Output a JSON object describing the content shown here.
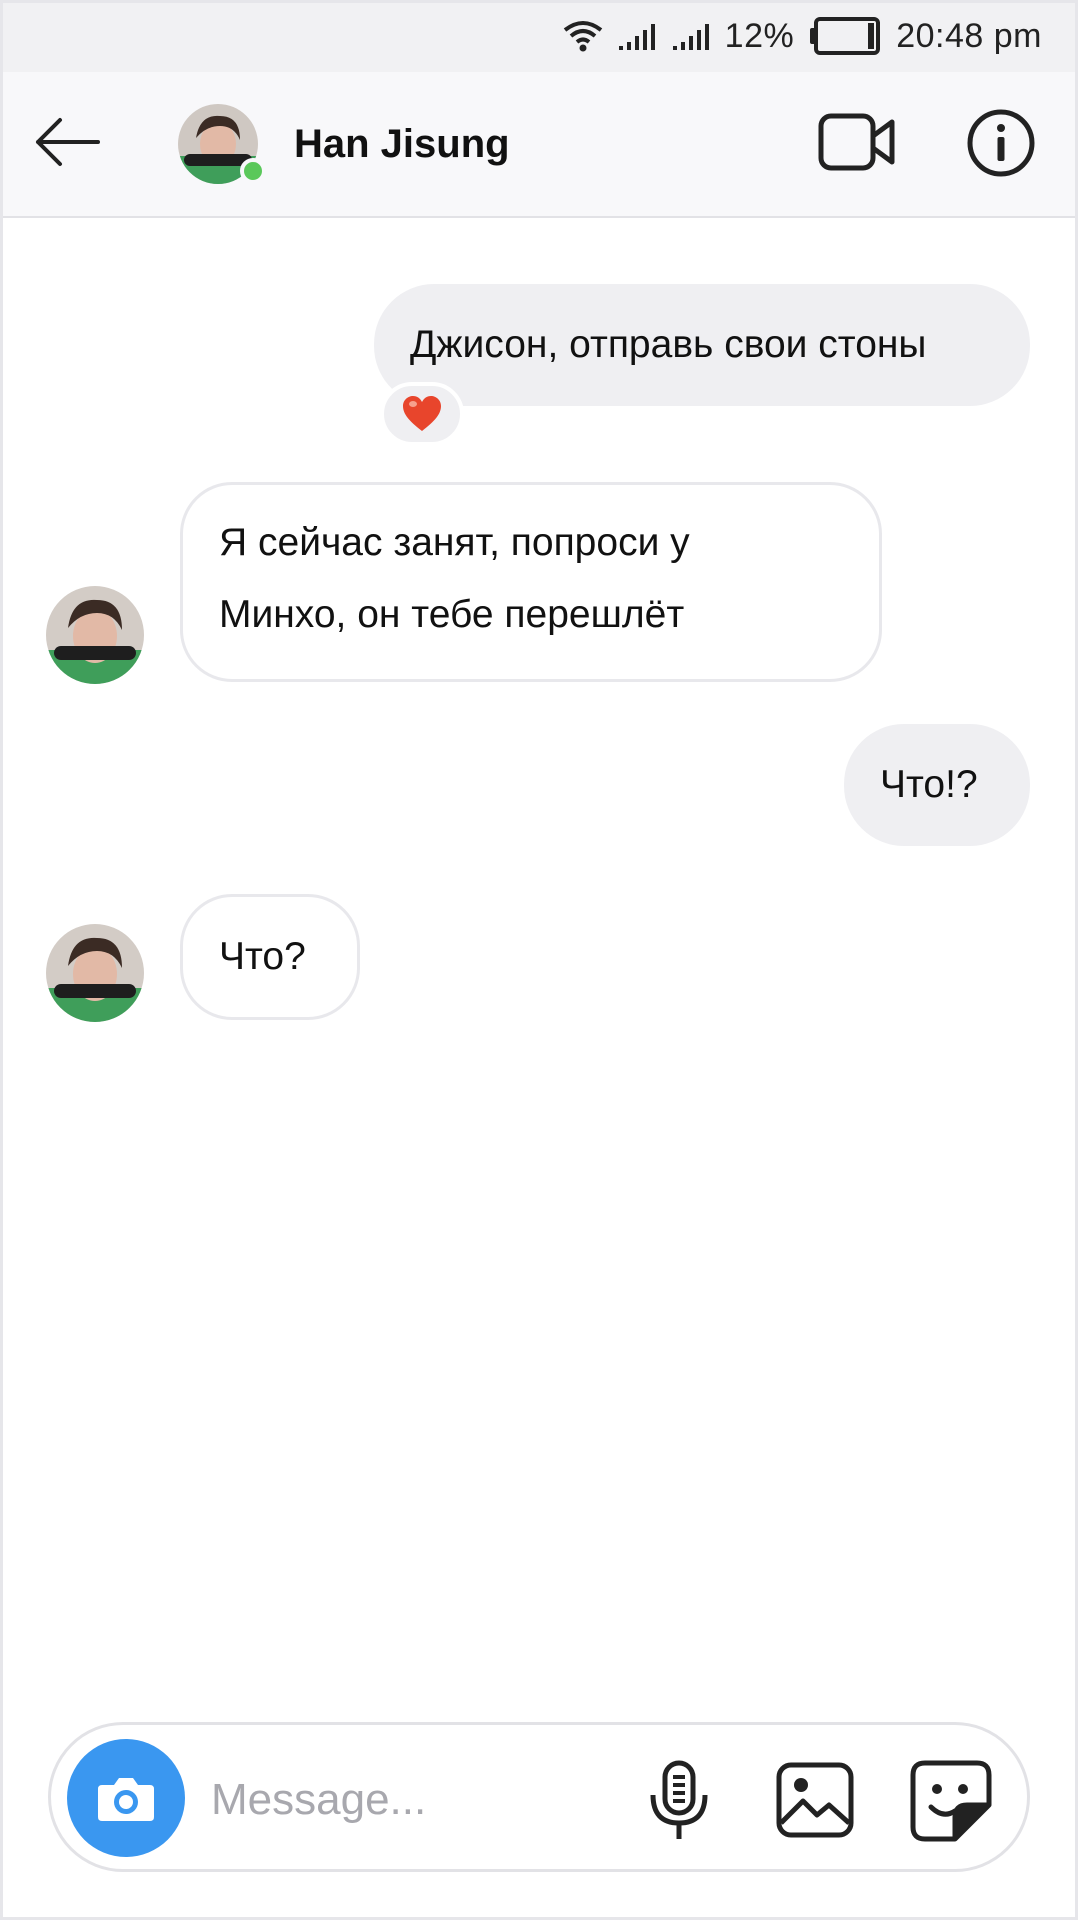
{
  "status_bar": {
    "battery_percent": "12%",
    "time": "20:48 pm",
    "icons": [
      "wifi-icon",
      "signal-icon",
      "signal-icon",
      "battery-icon"
    ]
  },
  "header": {
    "back_icon": "arrow-left-icon",
    "contact_name": "Han Jisung",
    "online": true,
    "video_icon": "video-camera-icon",
    "info_icon": "info-icon"
  },
  "messages": [
    {
      "direction": "outgoing",
      "text": "Джисон, отправь свои стоны",
      "reaction": "❤️"
    },
    {
      "direction": "incoming",
      "lines": [
        "Я сейчас занят, попроси у",
        "Минхо, он тебе перешлёт"
      ]
    },
    {
      "direction": "outgoing",
      "text": "Что!?"
    },
    {
      "direction": "incoming",
      "text": "Что?"
    }
  ],
  "composer": {
    "placeholder": "Message...",
    "value": "",
    "icons": [
      "camera-icon",
      "microphone-icon",
      "gallery-icon",
      "sticker-icon"
    ]
  },
  "colors": {
    "accent": "#3a97f0",
    "online": "#5ac85a",
    "outgoing_bubble": "#efeff2",
    "reaction_heart": "#e8452c"
  }
}
